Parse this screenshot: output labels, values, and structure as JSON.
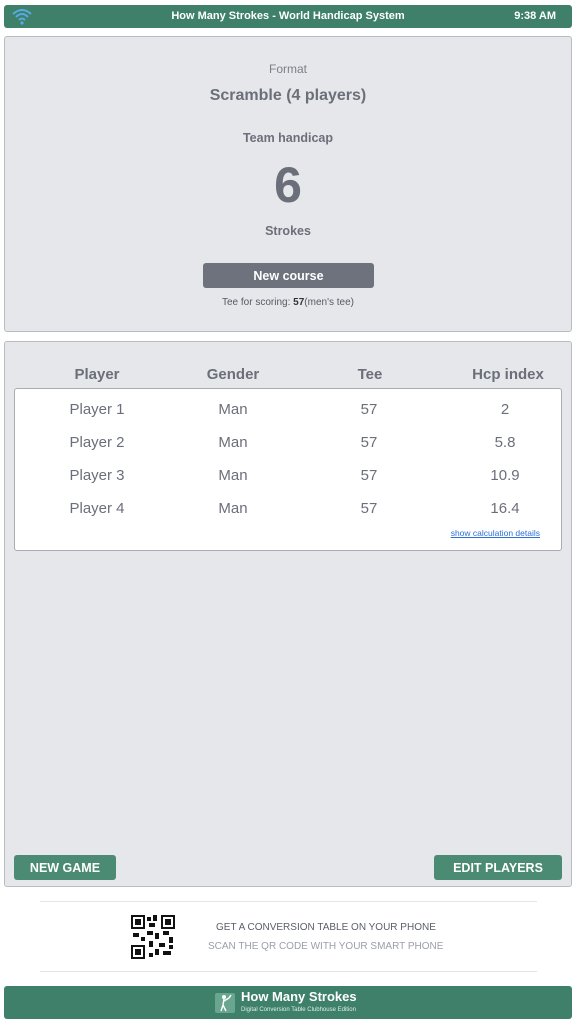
{
  "statusbar": {
    "title": "How Many Strokes - World Handicap System",
    "time": "9:38 AM",
    "wifi_icon": "wifi-icon"
  },
  "summary": {
    "format_label": "Format",
    "format_value": "Scramble (4 players)",
    "handicap_label": "Team handicap",
    "handicap_value": "6",
    "handicap_unit": "Strokes",
    "new_course_label": "New course",
    "tee_prefix": "Tee for scoring:",
    "tee_value": "57",
    "tee_suffix": "(men's tee)"
  },
  "players": {
    "headers": [
      "Player",
      "Gender",
      "Tee",
      "Hcp index"
    ],
    "rows": [
      [
        "Player 1",
        "Man",
        "57",
        "2"
      ],
      [
        "Player 2",
        "Man",
        "57",
        "5.8"
      ],
      [
        "Player 3",
        "Man",
        "57",
        "10.9"
      ],
      [
        "Player 4",
        "Man",
        "57",
        "16.4"
      ]
    ],
    "details_link": "show calculation details",
    "new_game_label": "NEW GAME",
    "edit_players_label": "EDIT PLAYERS"
  },
  "promo": {
    "line1": "GET A CONVERSION TABLE ON YOUR PHONE",
    "line2": "SCAN THE QR CODE WITH YOUR SMART PHONE",
    "qr_icon": "qr-code-icon"
  },
  "footer": {
    "brand": "How Many Strokes",
    "subtitle": "Digital Conversion Table Clubhouse Edition",
    "logo_icon": "golfer-logo-icon"
  },
  "colors": {
    "accent_green": "#3e8069",
    "button_green": "#4c8b73",
    "panel_bg": "#e6e7ea",
    "button_gray": "#6e727c"
  }
}
